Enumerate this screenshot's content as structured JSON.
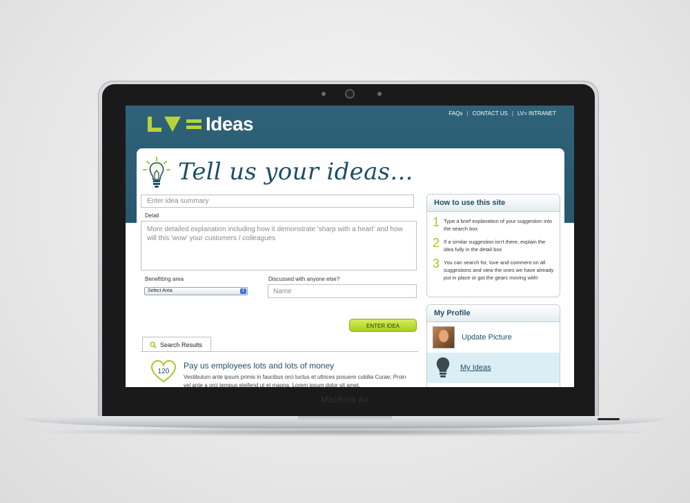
{
  "device": {
    "model_label": "MacBook Air"
  },
  "header": {
    "logo_ideas": "Ideas",
    "nav": [
      "FAQs",
      "CONTACT US",
      "LV= INTRANET"
    ],
    "nav_separator": "|"
  },
  "hero": {
    "headline": "Tell us your ideas..."
  },
  "form": {
    "summary_placeholder": "Enter idea summary",
    "detail_label": "Detail",
    "detail_placeholder": "More detailed explanation including how it demonstrate 'sharp with a heart' and how will this 'wow' your customers / colleagues",
    "benefitting_label": "Benefitting area",
    "benefitting_value": "Select Area",
    "discussed_label": "Discussed with anyone else?",
    "name_placeholder": "Name",
    "enter_button": "ENTER IDEA"
  },
  "results": {
    "tab_label": "Search Results",
    "items": [
      {
        "count": "120",
        "title": "Pay us employees lots and lots of money",
        "text": "Vestibulum ante ipsum primis in faucibus orci luctus et ultrices posuere cubilia Curae; Proin vel ante a orci tempus eleifend ut et magna. Lorem ipsum dolor sit amet,"
      }
    ]
  },
  "how_to": {
    "title": "How to use this site",
    "steps": [
      {
        "num": "1",
        "text": "Type a brief explanation of your suggestion into the search box"
      },
      {
        "num": "2",
        "text": "If a similar suggestion isn't there, explain the idea fully in the detail box"
      },
      {
        "num": "3",
        "text": "You can search for, love and comment on all suggestions and view the ones we have already put in place or got the gears moving with!"
      }
    ]
  },
  "profile": {
    "title": "My Profile",
    "update_picture": "Update Picture",
    "my_ideas": "My Ideas"
  },
  "colors": {
    "header_teal": "#2f6278",
    "accent_green": "#b6d33a",
    "text_blue": "#1f4f66"
  }
}
